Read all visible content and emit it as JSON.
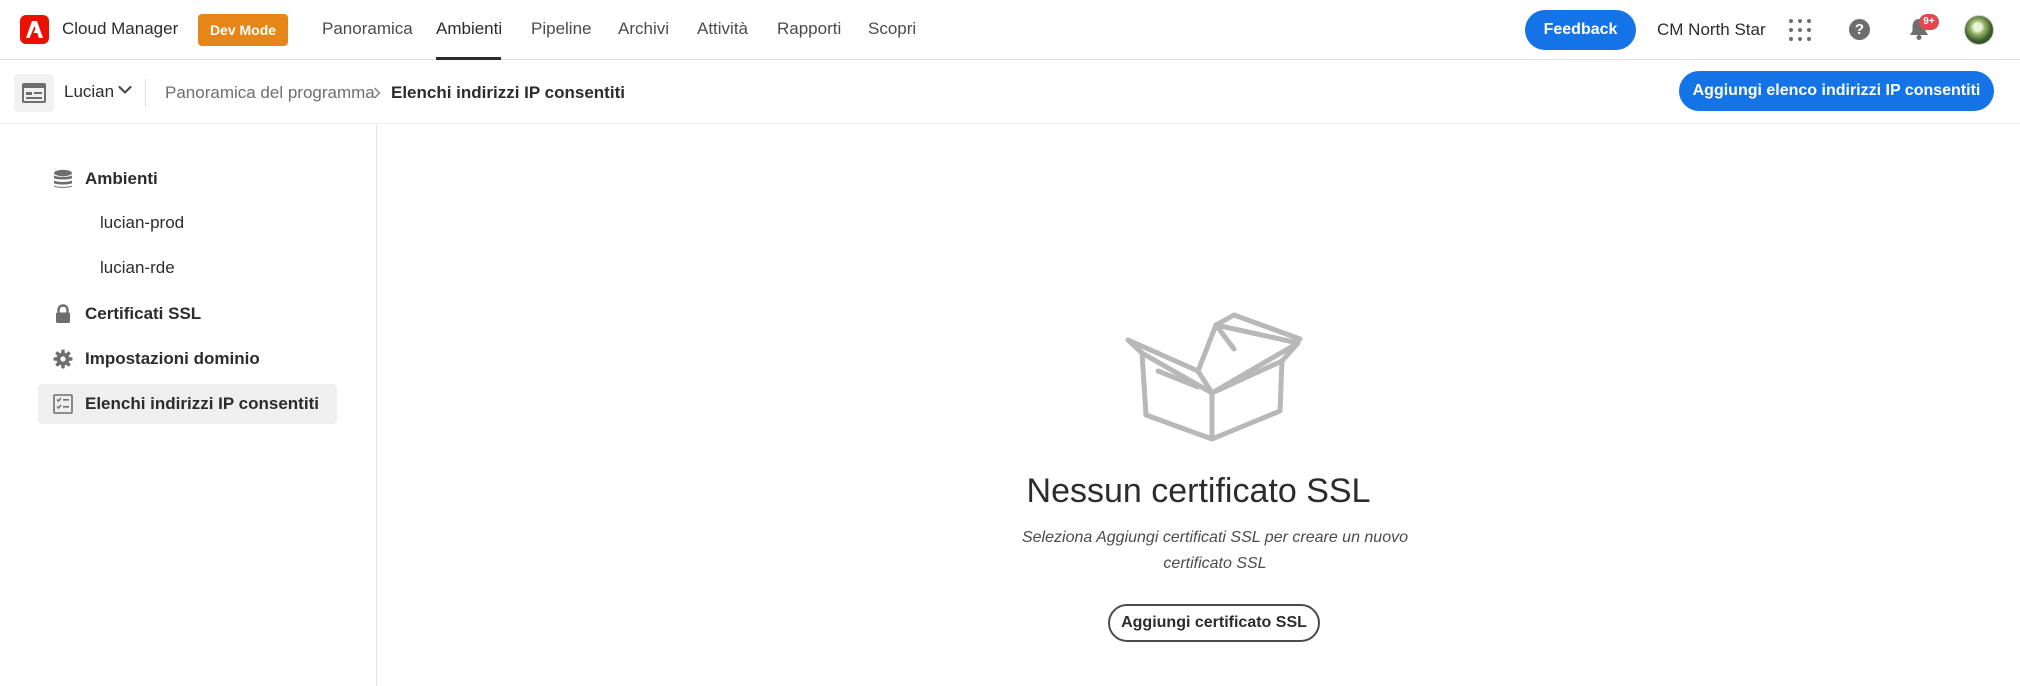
{
  "topbar": {
    "app_title": "Cloud Manager",
    "dev_mode": "Dev Mode",
    "nav": [
      "Panoramica",
      "Ambienti",
      "Pipeline",
      "Archivi",
      "Attività",
      "Rapporti",
      "Scopri"
    ],
    "active_nav": "Ambienti",
    "feedback": "Feedback",
    "org": "CM North Star",
    "notifications_badge": "9+"
  },
  "subbar": {
    "program": "Lucian",
    "breadcrumb": [
      "Panoramica del programma",
      "Elenchi indirizzi IP consentiti"
    ],
    "action_button": "Aggiungi elenco indirizzi IP consentiti"
  },
  "sidebar": {
    "items": [
      {
        "label": "Ambienti",
        "icon": "database-icon"
      },
      {
        "label": "Certificati SSL",
        "icon": "lock-icon"
      },
      {
        "label": "Impostazioni dominio",
        "icon": "gear-icon"
      },
      {
        "label": "Elenchi indirizzi IP consentiti",
        "icon": "checklist-icon",
        "active": true
      }
    ],
    "sub_items": [
      "lucian-prod",
      "lucian-rde"
    ]
  },
  "empty_state": {
    "title": "Nessun certificato SSL",
    "description": "Seleziona Aggiungi certificati SSL per creare un nuovo certificato SSL",
    "button": "Aggiungi certificato SSL"
  },
  "colors": {
    "accent": "#1473e6",
    "dev_mode": "#e68619",
    "adobe_red": "#eb1000"
  }
}
